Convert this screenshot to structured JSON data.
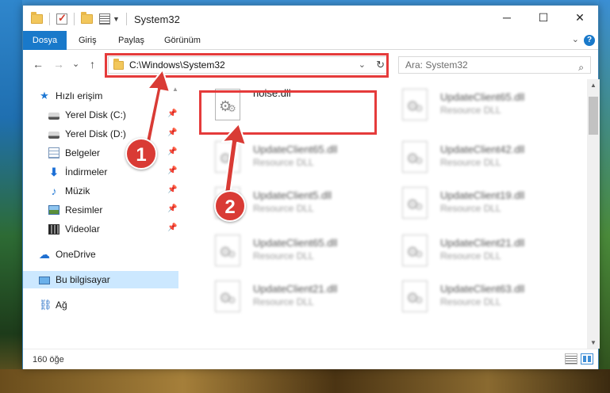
{
  "window": {
    "title": "System32",
    "minimize_icon": "─",
    "maximize_icon": "☐",
    "close_icon": "✕"
  },
  "ribbon": {
    "tabs": [
      "Dosya",
      "Giriş",
      "Paylaş",
      "Görünüm"
    ],
    "help": "?"
  },
  "nav": {
    "back": "←",
    "forward": "→",
    "recent": "⌄",
    "up": "↑",
    "address": "C:\\Windows\\System32",
    "refresh": "↻",
    "search_placeholder": "Ara: System32"
  },
  "sidebar": {
    "items": [
      {
        "label": "Hızlı erişim",
        "icon": "star-icon"
      },
      {
        "label": "Yerel Disk (C:)",
        "icon": "disk-icon",
        "pinned": true
      },
      {
        "label": "Yerel Disk (D:)",
        "icon": "disk-icon",
        "pinned": true
      },
      {
        "label": "Belgeler",
        "icon": "documents-icon",
        "pinned": true
      },
      {
        "label": "İndirmeler",
        "icon": "downloads-icon",
        "pinned": true
      },
      {
        "label": "Müzik",
        "icon": "music-icon",
        "pinned": true
      },
      {
        "label": "Resimler",
        "icon": "pictures-icon",
        "pinned": true
      },
      {
        "label": "Videolar",
        "icon": "videos-icon",
        "pinned": true
      },
      {
        "label": "OneDrive",
        "icon": "cloud-icon"
      },
      {
        "label": "Bu bilgisayar",
        "icon": "computer-icon",
        "selected": true
      },
      {
        "label": "Ağ",
        "icon": "network-icon"
      }
    ]
  },
  "files": [
    {
      "name": "noise.dll",
      "type": ""
    },
    {
      "name": "UpdateClient65.dll",
      "type": "Resource DLL"
    },
    {
      "name": "UpdateClient65.dll",
      "type": "Resource DLL"
    },
    {
      "name": "UpdateClient42.dll",
      "type": "Resource DLL"
    },
    {
      "name": "UpdateClient5.dll",
      "type": "Resource DLL"
    },
    {
      "name": "UpdateClient19.dll",
      "type": "Resource DLL"
    },
    {
      "name": "UpdateClient65.dll",
      "type": "Resource DLL"
    },
    {
      "name": "UpdateClient21.dll",
      "type": "Resource DLL"
    },
    {
      "name": "UpdateClient21.dll",
      "type": "Resource DLL"
    },
    {
      "name": "UpdateClient63.dll",
      "type": "Resource DLL"
    }
  ],
  "status": {
    "item_count": "160 öğe"
  },
  "callouts": [
    "1",
    "2"
  ],
  "colors": {
    "accent": "#1979ca",
    "highlight": "#e53b3b",
    "selection": "#cce8ff"
  }
}
